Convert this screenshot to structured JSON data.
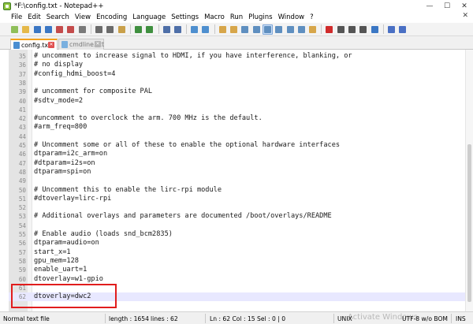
{
  "window": {
    "title": "*F:\\config.txt - Notepad++",
    "controls": {
      "minimize": "—",
      "maximize": "☐",
      "close": "✕"
    }
  },
  "menu": {
    "items": [
      "File",
      "Edit",
      "Search",
      "View",
      "Encoding",
      "Language",
      "Settings",
      "Macro",
      "Run",
      "Plugins",
      "Window",
      "?"
    ],
    "close_glyph": "✕"
  },
  "toolbar": {
    "buttons": [
      {
        "icon": "new-file-icon",
        "color": "#8fbf5a"
      },
      {
        "icon": "open-file-icon",
        "color": "#e5b94a"
      },
      {
        "icon": "save-icon",
        "color": "#3b77c4"
      },
      {
        "icon": "save-all-icon",
        "color": "#3b77c4"
      },
      {
        "icon": "close-file-icon",
        "color": "#c44b4b"
      },
      {
        "icon": "close-all-icon",
        "color": "#c44b4b"
      },
      {
        "icon": "print-icon",
        "color": "#7a7a7a"
      },
      {
        "sep": true
      },
      {
        "icon": "cut-icon",
        "color": "#6b6b6b"
      },
      {
        "icon": "copy-icon",
        "color": "#6b6b6b"
      },
      {
        "icon": "paste-icon",
        "color": "#c9a04a"
      },
      {
        "sep": true
      },
      {
        "icon": "undo-icon",
        "color": "#3f8f3f"
      },
      {
        "icon": "redo-icon",
        "color": "#3f8f3f"
      },
      {
        "sep": true
      },
      {
        "icon": "find-icon",
        "color": "#4e6fa8"
      },
      {
        "icon": "replace-icon",
        "color": "#4e6fa8"
      },
      {
        "sep": true
      },
      {
        "icon": "zoom-in-icon",
        "color": "#4e8fcf"
      },
      {
        "icon": "zoom-out-icon",
        "color": "#4e8fcf"
      },
      {
        "sep": true
      },
      {
        "icon": "sync-vertical-icon",
        "color": "#d7a64a"
      },
      {
        "icon": "sync-horizontal-icon",
        "color": "#d7a64a"
      },
      {
        "icon": "word-wrap-icon",
        "color": "#5f8fc0"
      },
      {
        "icon": "show-all-chars-icon",
        "color": "#5f8fc0"
      },
      {
        "icon": "indent-guide-icon",
        "color": "#5f8fc0",
        "active": true
      },
      {
        "icon": "language-icon",
        "color": "#5f8fc0"
      },
      {
        "icon": "doc-map-icon",
        "color": "#5f8fc0"
      },
      {
        "icon": "function-list-icon",
        "color": "#5f8fc0"
      },
      {
        "icon": "folder-workspace-icon",
        "color": "#d7a64a"
      },
      {
        "sep": true
      },
      {
        "icon": "record-macro-icon",
        "color": "#d02b2b"
      },
      {
        "icon": "stop-record-icon",
        "color": "#555555"
      },
      {
        "icon": "play-macro-icon",
        "color": "#555555"
      },
      {
        "icon": "run-macro-multiple-icon",
        "color": "#555555"
      },
      {
        "icon": "save-macro-icon",
        "color": "#3b77c4"
      },
      {
        "sep": true
      },
      {
        "icon": "spell-check-icon",
        "color": "#4a70c4"
      },
      {
        "icon": "spell-check-settings-icon",
        "color": "#4a70c4"
      }
    ]
  },
  "tabs": [
    {
      "label": "config.txt",
      "active": true,
      "icon": "file-modified-icon"
    },
    {
      "label": "cmdline.txt",
      "active": false,
      "icon": "file-icon"
    }
  ],
  "tab_close_glyph": "✕",
  "left_fragment": {
    "mark": "✕",
    "texts": [
      "tc",
      "ele"
    ]
  },
  "editor": {
    "current_line": 62,
    "lines": [
      {
        "n": "35",
        "text": "# uncomment to increase signal to HDMI, if you have interference, blanking, or"
      },
      {
        "n": "36",
        "text": "# no display"
      },
      {
        "n": "37",
        "text": "#config_hdmi_boost=4"
      },
      {
        "n": "38",
        "text": ""
      },
      {
        "n": "39",
        "text": "# uncomment for composite PAL"
      },
      {
        "n": "40",
        "text": "#sdtv_mode=2"
      },
      {
        "n": "41",
        "text": ""
      },
      {
        "n": "42",
        "text": "#uncomment to overclock the arm. 700 MHz is the default."
      },
      {
        "n": "43",
        "text": "#arm_freq=800"
      },
      {
        "n": "44",
        "text": ""
      },
      {
        "n": "45",
        "text": "# Uncomment some or all of these to enable the optional hardware interfaces"
      },
      {
        "n": "46",
        "text": "dtparam=i2c_arm=on"
      },
      {
        "n": "47",
        "text": "#dtparam=i2s=on"
      },
      {
        "n": "48",
        "text": "dtparam=spi=on"
      },
      {
        "n": "49",
        "text": ""
      },
      {
        "n": "50",
        "text": "# Uncomment this to enable the lirc-rpi module"
      },
      {
        "n": "51",
        "text": "#dtoverlay=lirc-rpi"
      },
      {
        "n": "52",
        "text": ""
      },
      {
        "n": "53",
        "text": "# Additional overlays and parameters are documented /boot/overlays/README"
      },
      {
        "n": "54",
        "text": ""
      },
      {
        "n": "55",
        "text": "# Enable audio (loads snd_bcm2835)"
      },
      {
        "n": "56",
        "text": "dtparam=audio=on"
      },
      {
        "n": "57",
        "text": "start_x=1"
      },
      {
        "n": "58",
        "text": "gpu_mem=128"
      },
      {
        "n": "59",
        "text": "enable_uart=1"
      },
      {
        "n": "60",
        "text": "dtoverlay=w1-gpio"
      },
      {
        "n": "61",
        "text": ""
      },
      {
        "n": "62",
        "text": "dtoverlay=dwc2"
      }
    ]
  },
  "status": {
    "file_type": "Normal text file",
    "length": "length : 1654",
    "lines": "lines : 62",
    "position": "Ln : 62    Col : 15    Sel : 0 | 0",
    "eol": "UNIX",
    "encoding": "UTF-8 w/o BOM",
    "mode": "INS",
    "watermark": "Activate Windows"
  }
}
